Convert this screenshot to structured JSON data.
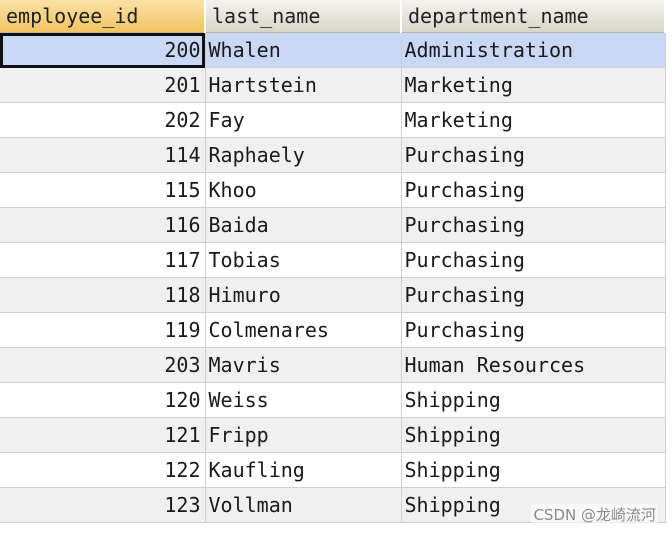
{
  "columns": [
    "employee_id",
    "last_name",
    "department_name"
  ],
  "rows": [
    {
      "employee_id": "200",
      "last_name": "Whalen",
      "department_name": "Administration"
    },
    {
      "employee_id": "201",
      "last_name": "Hartstein",
      "department_name": "Marketing"
    },
    {
      "employee_id": "202",
      "last_name": "Fay",
      "department_name": "Marketing"
    },
    {
      "employee_id": "114",
      "last_name": "Raphaely",
      "department_name": "Purchasing"
    },
    {
      "employee_id": "115",
      "last_name": "Khoo",
      "department_name": "Purchasing"
    },
    {
      "employee_id": "116",
      "last_name": "Baida",
      "department_name": "Purchasing"
    },
    {
      "employee_id": "117",
      "last_name": "Tobias",
      "department_name": "Purchasing"
    },
    {
      "employee_id": "118",
      "last_name": "Himuro",
      "department_name": "Purchasing"
    },
    {
      "employee_id": "119",
      "last_name": "Colmenares",
      "department_name": "Purchasing"
    },
    {
      "employee_id": "203",
      "last_name": "Mavris",
      "department_name": "Human Resources"
    },
    {
      "employee_id": "120",
      "last_name": "Weiss",
      "department_name": "Shipping"
    },
    {
      "employee_id": "121",
      "last_name": "Fripp",
      "department_name": "Shipping"
    },
    {
      "employee_id": "122",
      "last_name": "Kaufling",
      "department_name": "Shipping"
    },
    {
      "employee_id": "123",
      "last_name": "Vollman",
      "department_name": "Shipping"
    }
  ],
  "selected_row": 0,
  "watermark": "CSDN @龙崎流河",
  "colors": {
    "header_bg": "#d9d6c9",
    "sorted_header_bg": "#f2c463",
    "selected_row_bg": "#c9d9f5",
    "alt_row_bg": "#f0f0f0"
  }
}
